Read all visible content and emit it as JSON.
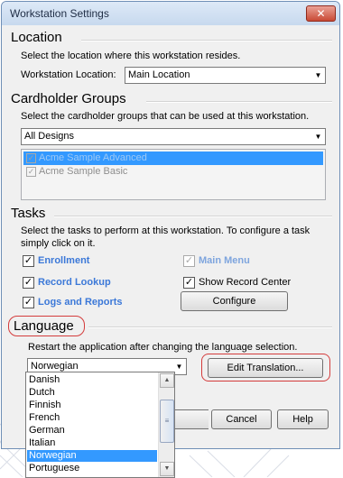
{
  "window": {
    "title": "Workstation Settings",
    "close_glyph": "✕"
  },
  "location": {
    "section_title": "Location",
    "description": "Select the location where this workstation resides.",
    "field_label": "Workstation Location:",
    "field_value": "Main Location"
  },
  "cardholder_groups": {
    "section_title": "Cardholder Groups",
    "description": "Select the cardholder groups that can be used at this workstation.",
    "filter_value": "All Designs",
    "items": [
      {
        "label": "Acme Sample Advanced",
        "checked": true,
        "selected": true
      },
      {
        "label": "Acme Sample Basic",
        "checked": true,
        "selected": false
      }
    ]
  },
  "tasks": {
    "section_title": "Tasks",
    "description_line1": "Select the tasks to perform at this workstation. To configure a task",
    "description_line2": "simply click on it.",
    "items": [
      {
        "label": "Enrollment",
        "checked": true
      },
      {
        "label": "Record Lookup",
        "checked": true
      },
      {
        "label": "Logs and Reports",
        "checked": true
      },
      {
        "label": "Main Menu",
        "checked": true,
        "disabled": true
      },
      {
        "label": "Show Record Center",
        "checked": true
      }
    ],
    "configure_label": "Configure"
  },
  "language": {
    "section_title": "Language",
    "description": "Restart the application after changing the language selection.",
    "selected_value": "Norwegian",
    "edit_translation_label": "Edit Translation...",
    "options": [
      "Danish",
      "Dutch",
      "Finnish",
      "French",
      "German",
      "Italian",
      "Norwegian",
      "Portuguese"
    ],
    "selected_index": 6
  },
  "footer": {
    "cancel_label": "Cancel",
    "help_label": "Help"
  },
  "glyphs": {
    "check": "✓",
    "down_arrow": "▼",
    "up_arrow": "▲",
    "grip": "≡"
  },
  "colors": {
    "highlight_oval": "#d43c3c",
    "selection": "#3399ff",
    "link": "#3b78d8"
  }
}
